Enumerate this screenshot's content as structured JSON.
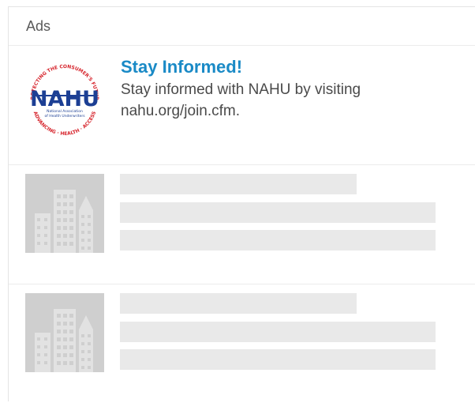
{
  "panel": {
    "title": "Ads"
  },
  "ads": [
    {
      "logo_text": "NAHU",
      "logo_subtext": "National Association of Health Underwriters",
      "logo_ring_text": "PROTECTING THE CONSUMER'S FUTURE",
      "title": "Stay Informed!",
      "description": "Stay informed with NAHU by visiting nahu.org/join.cfm."
    }
  ],
  "placeholders": [
    {
      "icon": "building-icon"
    },
    {
      "icon": "building-icon"
    }
  ],
  "colors": {
    "title_link": "#1a8ac6",
    "logo_navy": "#1c3f94",
    "logo_red": "#d6232b",
    "placeholder_thumb": "#cfcfcf",
    "placeholder_line": "#e9e9e9"
  }
}
